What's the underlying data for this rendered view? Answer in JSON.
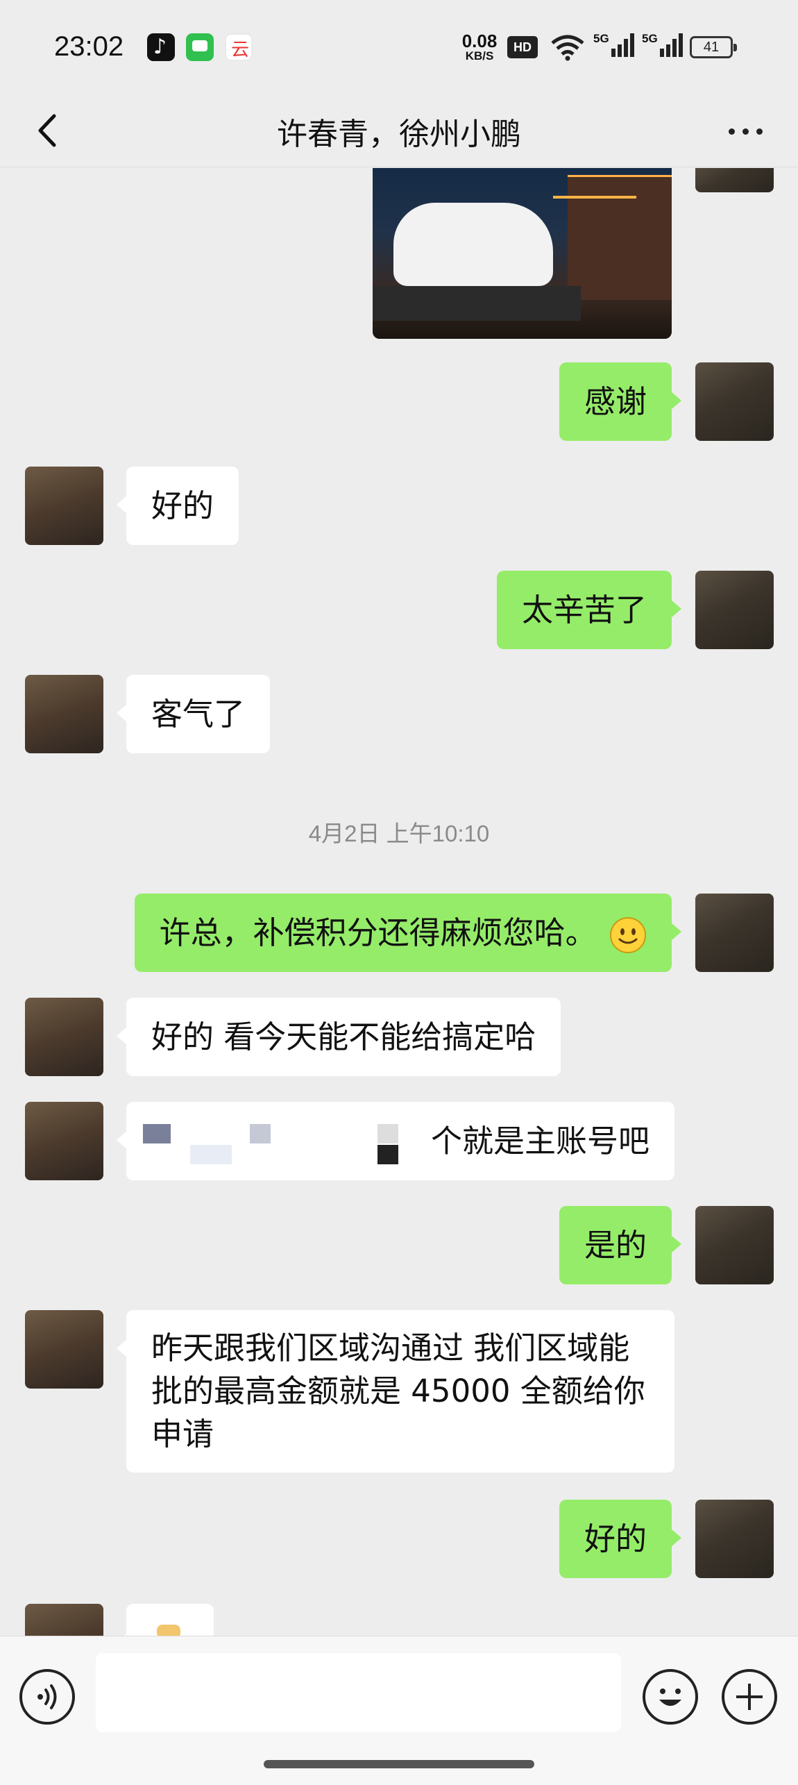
{
  "status_bar": {
    "time": "23:02",
    "net_speed_value": "0.08",
    "net_speed_unit": "KB/S",
    "hd_label": "HD",
    "sim1_label": "5G",
    "sim2_label": "5G",
    "battery": "41",
    "apps": [
      "tiktok-icon",
      "message-icon",
      "cloud-icon"
    ]
  },
  "header": {
    "title": "许春青，徐州小鹏",
    "back_icon": "chevron-left-icon",
    "more_icon": "more-dots-icon"
  },
  "messages": [
    {
      "from": "me",
      "type": "image"
    },
    {
      "from": "me",
      "text": "感谢"
    },
    {
      "from": "other",
      "text": "好的"
    },
    {
      "from": "me",
      "text": "太辛苦了"
    },
    {
      "from": "other",
      "text": "客气了"
    },
    {
      "type": "timestamp",
      "text": "4月2日 上午10:10"
    },
    {
      "from": "me",
      "text": "许总，补偿积分还得麻烦您哈。",
      "emoji": "smile-emoji"
    },
    {
      "from": "other",
      "text": "好的 看今天能不能给搞定哈"
    },
    {
      "from": "other",
      "text": "个就是主账号吧",
      "redacted_prefix": true
    },
    {
      "from": "me",
      "text": "是的"
    },
    {
      "from": "other",
      "text": "昨天跟我们区域沟通过 我们区域能批的最高金额就是 45000 全额给你申请"
    },
    {
      "from": "me",
      "text": "好的"
    },
    {
      "from": "other",
      "type": "emoji-partial"
    }
  ],
  "input_bar": {
    "voice_icon": "voice-icon",
    "emoji_icon": "emoji-face-icon",
    "plus_icon": "plus-icon",
    "input_value": ""
  },
  "colors": {
    "background": "#ededed",
    "bubble_me": "#95ec69",
    "bubble_other": "#ffffff"
  }
}
